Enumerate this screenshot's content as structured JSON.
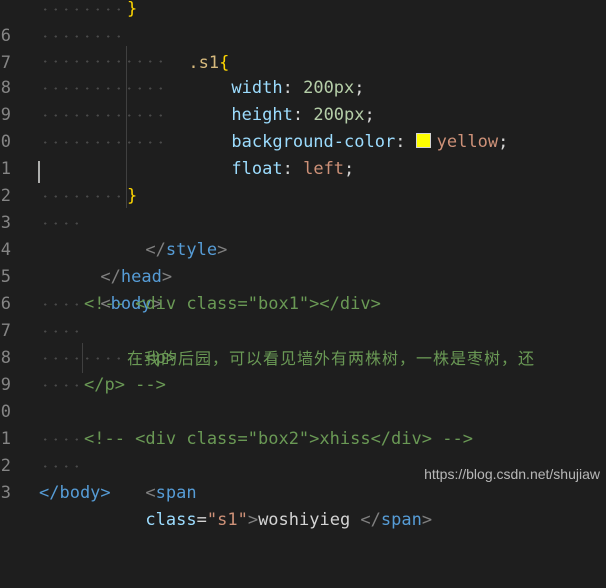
{
  "editor": {
    "lines": [
      {
        "n": "6",
        "indent": 2
      },
      {
        "n": "7",
        "indent": 2
      },
      {
        "n": "8",
        "indent": 3
      },
      {
        "n": "9",
        "indent": 3
      },
      {
        "n": "0",
        "indent": 3
      },
      {
        "n": "1",
        "indent": 3
      },
      {
        "n": "2",
        "indent": 0
      },
      {
        "n": "3",
        "indent": 2
      },
      {
        "n": "4",
        "indent": 1
      },
      {
        "n": "5",
        "indent": 0
      },
      {
        "n": "6",
        "indent": 0
      },
      {
        "n": "7",
        "indent": 1
      },
      {
        "n": "8",
        "indent": 1
      },
      {
        "n": "9",
        "indent": 2
      },
      {
        "n": "0",
        "indent": 1
      },
      {
        "n": "1",
        "indent": 0
      },
      {
        "n": "2",
        "indent": 1
      },
      {
        "n": "3",
        "indent": 1
      }
    ],
    "code": {
      "l6_brace": "}",
      "l7_sel": ".s1",
      "l7_brace": "{",
      "l8_prop": "width",
      "l8_val": "200px",
      "l9_prop": "height",
      "l9_val": "200px",
      "l10_prop": "background-color",
      "l10_val": "yellow",
      "l11_prop": "float",
      "l11_val": "left",
      "l13_brace": "}",
      "l14_tag": "style",
      "l15_tag": "head",
      "l16_tag": "body",
      "l17_comment": "<!-- <div class=\"box1\"></div>",
      "l18_tag": "p",
      "l19_text": "在我的后园，可以看见墙外有两株树，一株是枣树，还",
      "l20_comment": "</p> -->",
      "l22_comment": "<!-- <div class=\"box2\">xhiss</div> -->",
      "l23_tag": "span",
      "l23_attr": "class",
      "l23_str": "\"s1\"",
      "l23_text": "woshiyieg ",
      "l23_close": "span",
      "l24_partial": "</body>"
    },
    "swatch_color": "#ffff00"
  },
  "watermark": "https://blog.csdn.net/shujiaw"
}
